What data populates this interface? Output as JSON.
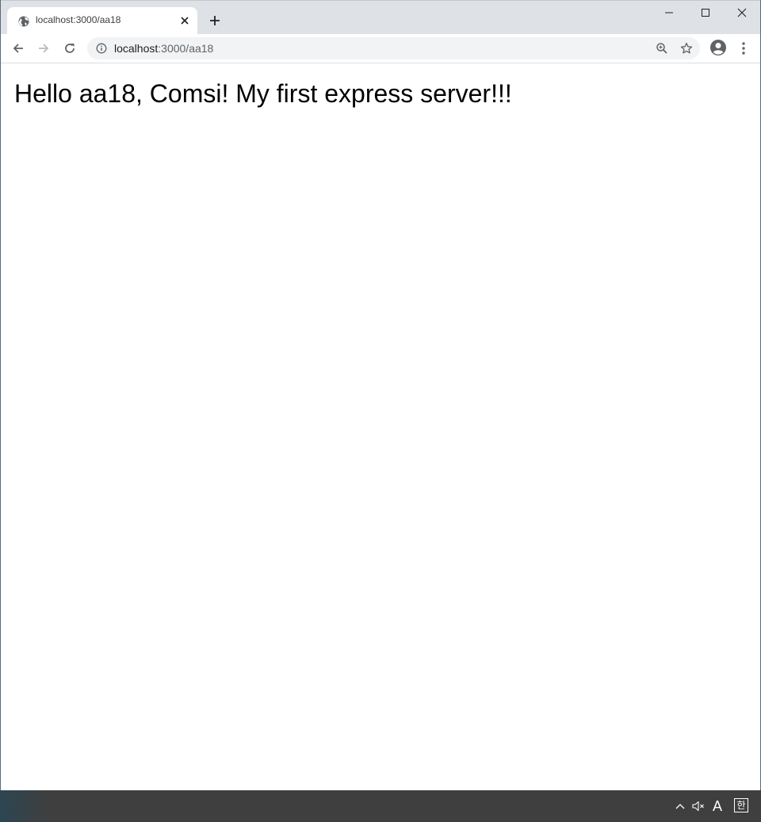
{
  "browser": {
    "tab": {
      "title": "localhost:3000/aa18"
    },
    "address_bar": {
      "host": "localhost",
      "path": ":3000/aa18"
    }
  },
  "page": {
    "greeting": "Hello aa18, Comsi! My first express server!!!"
  },
  "taskbar": {
    "ime_mode": "A",
    "ime_language": "한"
  },
  "icons": {
    "tab_favicon": "globe-icon",
    "tab_close": "close-icon",
    "new_tab": "plus-icon",
    "minimize": "minimize-icon",
    "maximize": "maximize-icon",
    "close_window": "close-icon",
    "back": "arrow-left-icon",
    "forward": "arrow-right-icon",
    "reload": "reload-icon",
    "site_info": "info-icon",
    "zoom": "zoom-icon",
    "bookmark": "star-icon",
    "profile": "account-circle-icon",
    "menu": "more-vert-icon",
    "tray_overflow": "chevron-up-icon",
    "volume": "volume-muted-icon"
  },
  "colors": {
    "tabstrip": "#dee1e6",
    "omnibox": "#f1f3f4",
    "taskbar": "#3f3f3f",
    "icon": "#5f6368"
  }
}
